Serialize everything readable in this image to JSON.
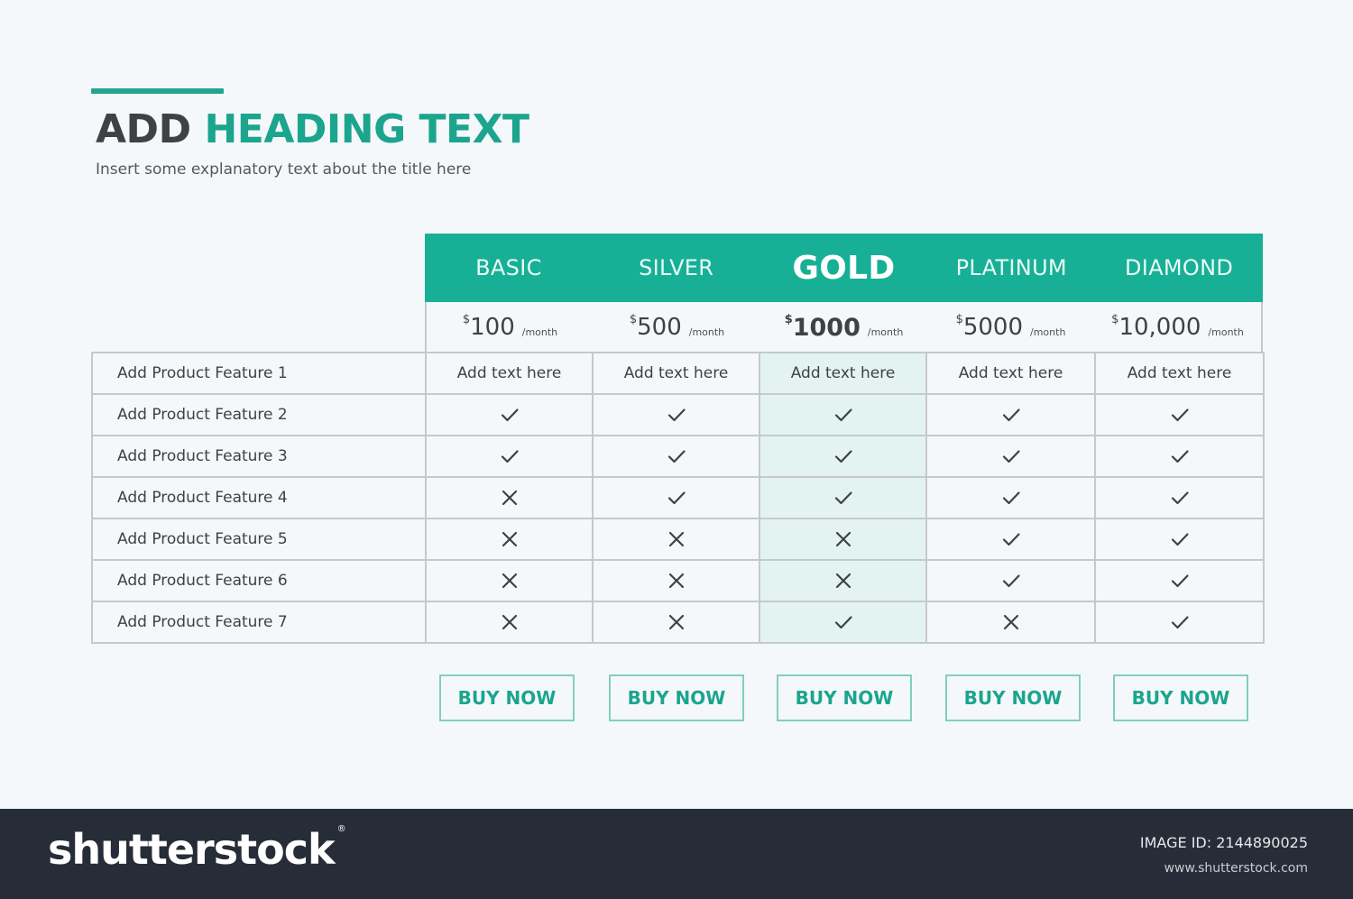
{
  "heading": {
    "part1": "ADD",
    "part2": "HEADING TEXT",
    "subtitle": "Insert some explanatory text about the title here"
  },
  "colors": {
    "accent": "#17b096",
    "heading_dark": "#3e4244",
    "featured_column": "#e3f3f1",
    "footer_bg": "#272d38"
  },
  "plans": [
    {
      "name": "BASIC",
      "currency": "$",
      "price": "100",
      "period": "/month",
      "featured": false,
      "button": "BUY NOW"
    },
    {
      "name": "SILVER",
      "currency": "$",
      "price": "500",
      "period": "/month",
      "featured": false,
      "button": "BUY NOW"
    },
    {
      "name": "GOLD",
      "currency": "$",
      "price": "1000",
      "period": "/month",
      "featured": true,
      "button": "BUY NOW"
    },
    {
      "name": "PLATINUM",
      "currency": "$",
      "price": "5000",
      "period": "/month",
      "featured": false,
      "button": "BUY NOW"
    },
    {
      "name": "DIAMOND",
      "currency": "$",
      "price": "10,000",
      "period": "/month",
      "featured": false,
      "button": "BUY NOW"
    }
  ],
  "features": [
    {
      "label": "Add Product Feature 1",
      "values": [
        "Add text here",
        "Add text here",
        "Add text here",
        "Add text here",
        "Add text here"
      ]
    },
    {
      "label": "Add Product Feature 2",
      "values": [
        "check",
        "check",
        "check",
        "check",
        "check"
      ]
    },
    {
      "label": "Add Product Feature 3",
      "values": [
        "check",
        "check",
        "check",
        "check",
        "check"
      ]
    },
    {
      "label": "Add Product Feature 4",
      "values": [
        "cross",
        "check",
        "check",
        "check",
        "check"
      ]
    },
    {
      "label": "Add Product Feature 5",
      "values": [
        "cross",
        "cross",
        "cross",
        "check",
        "check"
      ]
    },
    {
      "label": "Add Product Feature 6",
      "values": [
        "cross",
        "cross",
        "cross",
        "check",
        "check"
      ]
    },
    {
      "label": "Add Product Feature 7",
      "values": [
        "cross",
        "cross",
        "check",
        "cross",
        "check"
      ]
    }
  ],
  "footer": {
    "logo": "shutterstock",
    "logo_mark": "®",
    "image_id": "IMAGE ID: 2144890025",
    "site": "www.shutterstock.com"
  }
}
